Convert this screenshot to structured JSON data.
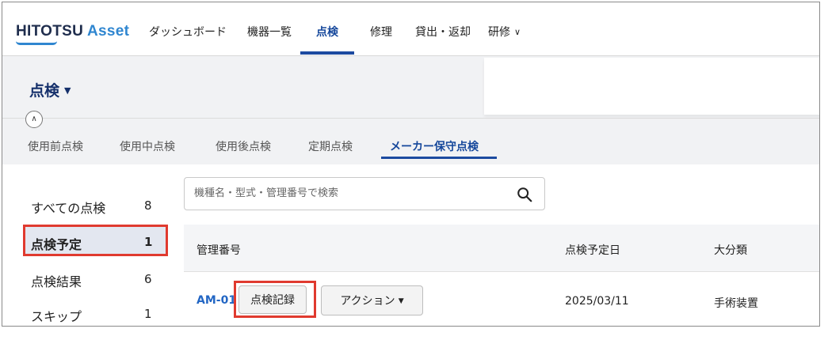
{
  "app": {
    "logo_part1": "HITOTSU",
    "logo_part2": "Asset"
  },
  "nav": {
    "items": [
      {
        "label": "ダッシュボード"
      },
      {
        "label": "機器一覧"
      },
      {
        "label": "点検"
      },
      {
        "label": "修理"
      },
      {
        "label": "貸出・返却"
      },
      {
        "label": "研修"
      }
    ],
    "active": "点検"
  },
  "page": {
    "title": "点検"
  },
  "tabs": [
    {
      "label": "使用前点検"
    },
    {
      "label": "使用中点検"
    },
    {
      "label": "使用後点検"
    },
    {
      "label": "定期点検"
    },
    {
      "label": "メーカー保守点検"
    }
  ],
  "active_tab": "メーカー保守点検",
  "sidebar": {
    "items": [
      {
        "label": "すべての点検",
        "count": "8"
      },
      {
        "label": "点検予定",
        "count": "1"
      },
      {
        "label": "点検結果",
        "count": "6"
      },
      {
        "label": "スキップ",
        "count": "1"
      }
    ],
    "selected": "点検予定"
  },
  "search": {
    "placeholder": "機種名・型式・管理番号で検索",
    "value": ""
  },
  "table": {
    "columns": [
      "管理番号",
      "点検予定日",
      "大分類"
    ],
    "rows": [
      {
        "asset_id": "AM-01",
        "record_button": "点検記録",
        "action_button": "アクション",
        "scheduled_date": "2025/03/11",
        "category": "手術装置"
      }
    ]
  },
  "colors": {
    "brand_dark": "#1f2d4d",
    "brand_blue": "#2f86d0",
    "active_nav": "#1c4aa0",
    "highlight_red": "#e03a2f",
    "link_blue": "#2266c4"
  }
}
